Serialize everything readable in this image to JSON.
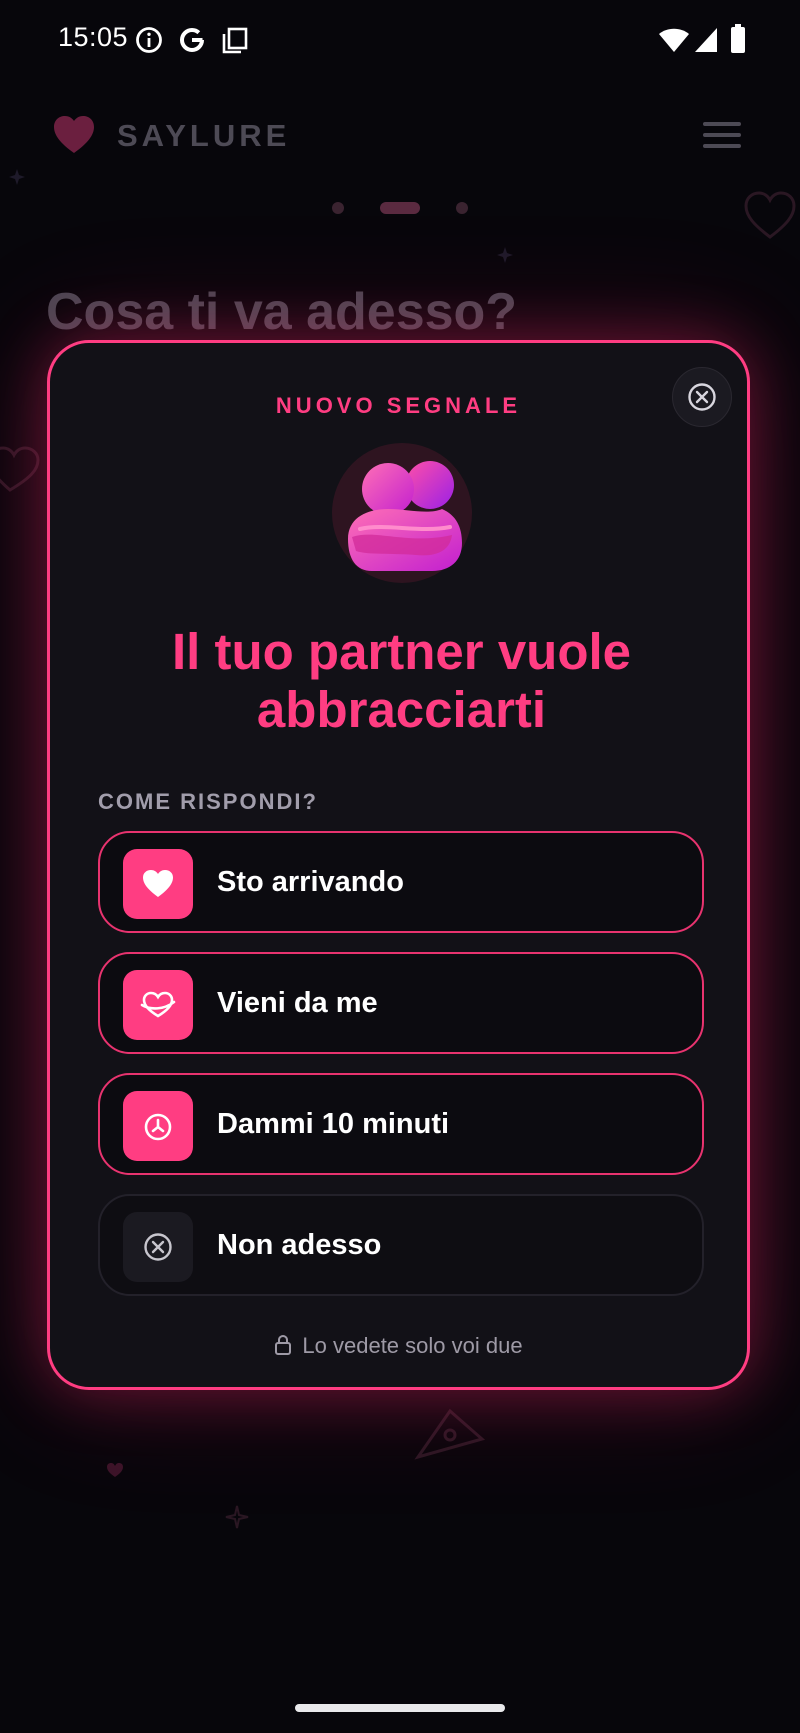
{
  "status_bar": {
    "time": "15:05",
    "left_icons": [
      "info-icon",
      "google-icon",
      "copy-icon"
    ],
    "right_icons": [
      "wifi-icon",
      "signal-icon",
      "battery-icon"
    ]
  },
  "background_app": {
    "brand": "SAYLURE",
    "title": "Cosa ti va adesso?"
  },
  "modal": {
    "eyebrow": "NUOVO SEGNALE",
    "headline": "Il tuo partner vuole abbracciarti",
    "section_label": "COME RISPONDI?",
    "options": [
      {
        "label": "Sto arrivando",
        "icon": "heart-icon"
      },
      {
        "label": "Vieni da me",
        "icon": "hug-heart-icon"
      },
      {
        "label": "Dammi 10 minuti",
        "icon": "timer-icon"
      },
      {
        "label": "Non adesso",
        "icon": "close-circle-icon"
      }
    ],
    "footer_note": "Lo vedete solo voi due"
  },
  "colors": {
    "accent": "#ff3d82",
    "modal_bg": "#121117",
    "page_bg": "#07060b"
  }
}
